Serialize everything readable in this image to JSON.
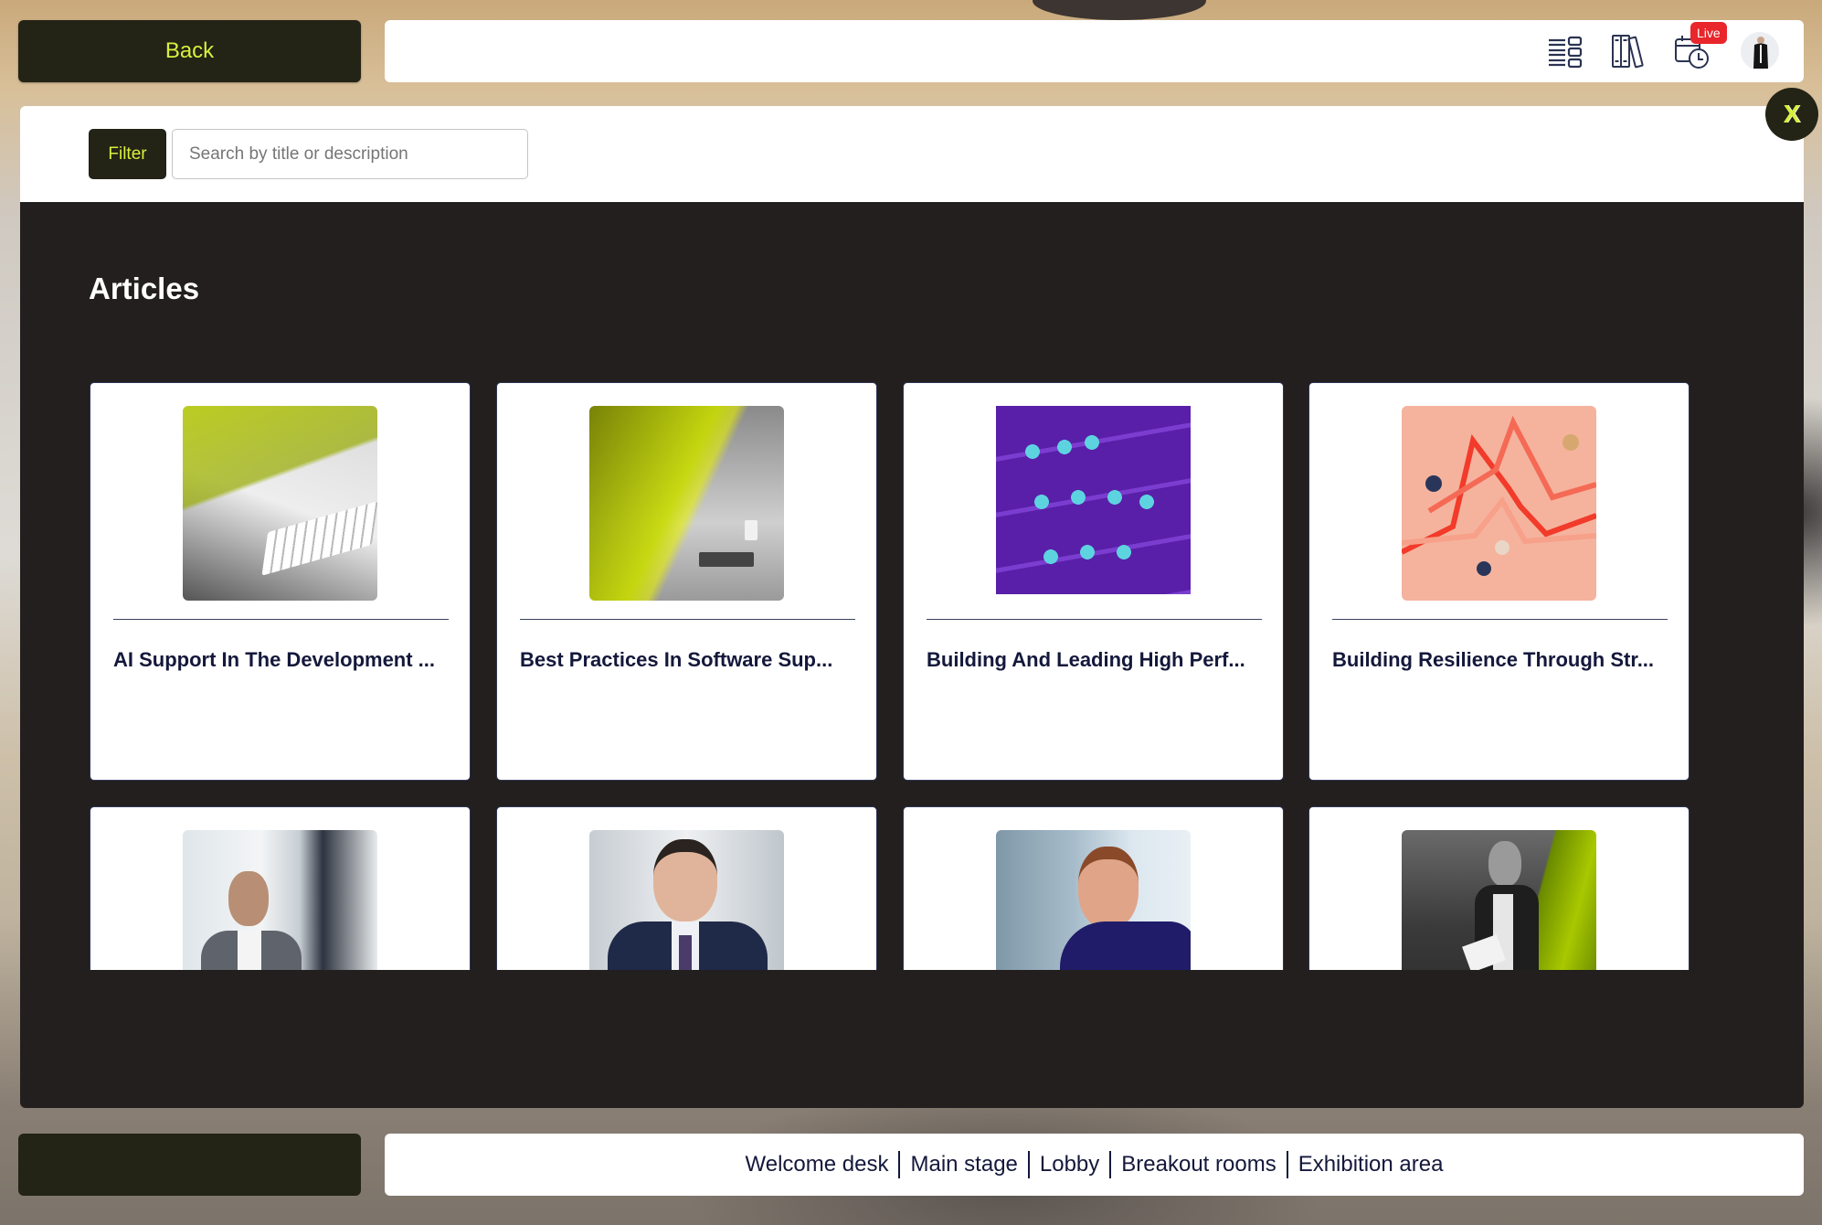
{
  "header": {
    "back_label": "Back",
    "icons": [
      "agenda-list-icon",
      "library-books-icon",
      "schedule-calendar-icon",
      "user-avatar"
    ],
    "live_badge": "Live"
  },
  "modal": {
    "close_label": "X",
    "filter_label": "Filter",
    "search": {
      "placeholder": "Search by title or description",
      "value": ""
    },
    "section_title": "Articles",
    "articles": [
      {
        "title": "AI Support In The Development ...",
        "image": "laptop-keyboard-yellow-photo"
      },
      {
        "title": "Best Practices In Software Sup...",
        "image": "monitor-code-yellow-photo"
      },
      {
        "title": "Building And Leading High Perf...",
        "image": "tandem-bike-team-illustration"
      },
      {
        "title": "Building Resilience Through Str...",
        "image": "people-on-chart-lines-photo"
      },
      {
        "title": "",
        "image": "man-in-grey-suit-photo"
      },
      {
        "title": "",
        "image": "smiling-man-in-navy-suit-photo"
      },
      {
        "title": "",
        "image": "man-with-glasses-photo"
      },
      {
        "title": "",
        "image": "man-with-papers-yellow-photo"
      }
    ]
  },
  "bottom_nav": {
    "items": [
      "Welcome desk",
      "Main stage",
      "Lobby",
      "Breakout rooms",
      "Exhibition area"
    ]
  },
  "colors": {
    "accent": "#d6f03c",
    "dark": "#232316",
    "panel": "#231f1f",
    "title_text": "#14183b",
    "live": "#e8262b"
  }
}
